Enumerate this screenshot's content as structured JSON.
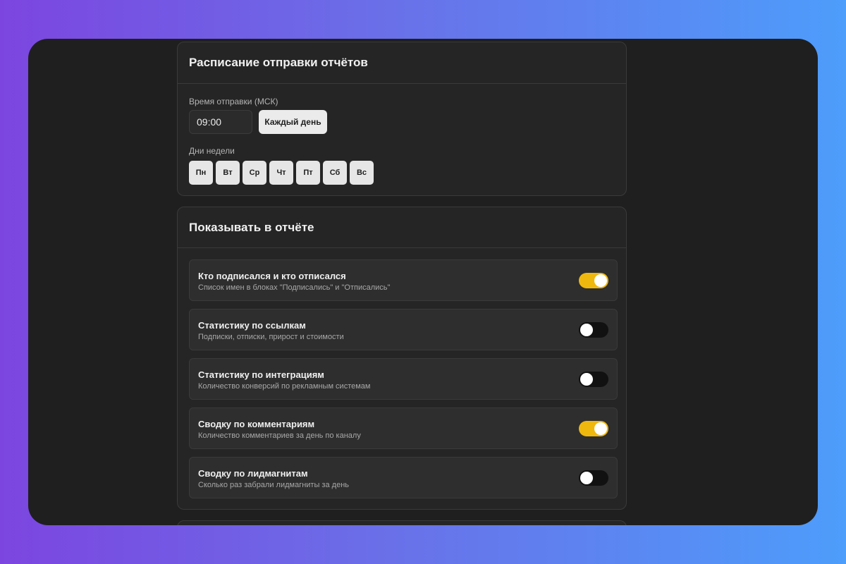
{
  "schedule": {
    "title": "Расписание отправки отчётов",
    "time_label": "Время отправки (МСК)",
    "time_value": "09:00",
    "everyday_button": "Каждый день",
    "days_label": "Дни недели",
    "days": [
      "Пн",
      "Вт",
      "Ср",
      "Чт",
      "Пт",
      "Сб",
      "Вс"
    ]
  },
  "report": {
    "title": "Показывать в отчёте",
    "options": [
      {
        "title": "Кто подписался и кто отписался",
        "description": "Список имен в блоках \"Подписались\" и \"Отписались\"",
        "enabled": true
      },
      {
        "title": "Статистику по ссылкам",
        "description": "Подписки, отписки, прирост и стоимости",
        "enabled": false
      },
      {
        "title": "Статистику по интеграциям",
        "description": "Количество конверсий по рекламным системам",
        "enabled": false
      },
      {
        "title": "Сводку по комментариям",
        "description": "Количество комментариев за день по каналу",
        "enabled": true
      },
      {
        "title": "Сводку по лидмагнитам",
        "description": "Сколько раз забрали лидмагниты за день",
        "enabled": false
      }
    ]
  },
  "colors": {
    "toggle_on": "#efb80f",
    "toggle_off": "#111111",
    "panel_bg": "#1f1f1f"
  }
}
